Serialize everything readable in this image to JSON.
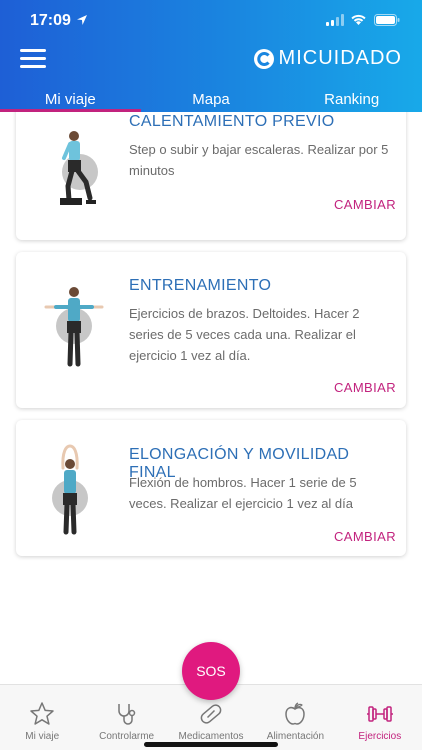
{
  "status_bar": {
    "time": "17:09"
  },
  "header": {
    "brand": "MICUIDADO"
  },
  "tabs": [
    {
      "label": "Mi viaje",
      "active": true
    },
    {
      "label": "Mapa",
      "active": false
    },
    {
      "label": "Ranking",
      "active": false
    }
  ],
  "cards": [
    {
      "title": "CALENTAMIENTO PREVIO",
      "description": "Step o subir y bajar escaleras. Realizar por 5 minutos",
      "action": "CAMBIAR",
      "figure_icon": "step-exercise-figure"
    },
    {
      "title": "ENTRENAMIENTO",
      "description": "Ejercicios de brazos. Deltoides. Hacer 2 series de 5 veces cada una. Realizar el ejercicio 1 vez al día.",
      "action": "CAMBIAR",
      "figure_icon": "arms-raised-sideways-figure"
    },
    {
      "title": "ELONGACIÓN Y MOVILIDAD FINAL",
      "description": "Flexión de hombros. Hacer 1 serie de 5 veces. Realizar el ejercicio 1 vez al día",
      "action": "CAMBIAR",
      "figure_icon": "arms-raised-overhead-figure"
    }
  ],
  "sos": {
    "label": "SOS"
  },
  "bottom_nav": [
    {
      "label": "Mi viaje",
      "icon": "star-icon",
      "active": false
    },
    {
      "label": "Controlarme",
      "icon": "stethoscope-icon",
      "active": false
    },
    {
      "label": "Medicamentos",
      "icon": "pill-icon",
      "active": false
    },
    {
      "label": "Alimentación",
      "icon": "apple-icon",
      "active": false
    },
    {
      "label": "Ejercicios",
      "icon": "dumbbell-icon",
      "active": true
    }
  ],
  "colors": {
    "header_start": "#1e5fd6",
    "header_end": "#18a9e9",
    "accent": "#c2237e",
    "sos": "#e0197f",
    "title_blue": "#2d6fb6"
  }
}
